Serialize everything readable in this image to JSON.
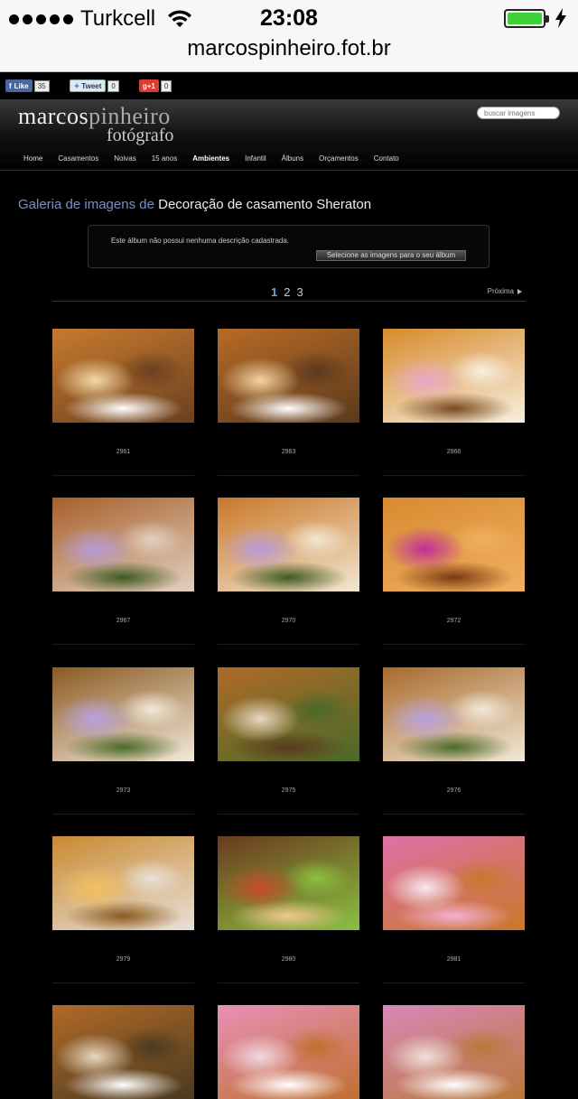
{
  "status": {
    "carrier": "Turkcell",
    "time": "23:08"
  },
  "url": "marcospinheiro.fot.br",
  "social": {
    "like_label": "Like",
    "like_count": "35",
    "tweet_label": "Tweet",
    "tweet_count": "0",
    "gplus_label": "g+1",
    "gplus_count": "0"
  },
  "logo": {
    "part1": "marcos",
    "part2": "pinheiro",
    "line2": "fotógrafo"
  },
  "search": {
    "placeholder": "buscar imagens"
  },
  "nav": [
    "Home",
    "Casamentos",
    "Noivas",
    "15 anos",
    "Ambientes",
    "Infantil",
    "Álbuns",
    "Orçamentos",
    "Contato"
  ],
  "nav_active": "Ambientes",
  "gallery": {
    "prefix": "Galeria de imagens de",
    "name": "Decoração de casamento Sheraton",
    "description": "Este álbum não possui nenhuma descrição cadastrada.",
    "select_button": "Selecione as imagens para o seu álbum"
  },
  "pagination": {
    "pages": [
      "1",
      "2",
      "3"
    ],
    "current": "1",
    "next_label": "Próxima"
  },
  "photos": [
    {
      "id": "2961",
      "palette": [
        "#c77a2e",
        "#f3d9a8",
        "#6b4020",
        "#fff"
      ]
    },
    {
      "id": "2963",
      "palette": [
        "#b86a26",
        "#f2d3a0",
        "#5b3a1c",
        "#fff"
      ]
    },
    {
      "id": "2966",
      "palette": [
        "#d78b2a",
        "#e9a6c8",
        "#f7efe0",
        "#7a4a20"
      ]
    },
    {
      "id": "2967",
      "palette": [
        "#a7602a",
        "#b79ad8",
        "#e2d0c0",
        "#3e5a22"
      ]
    },
    {
      "id": "2970",
      "palette": [
        "#c9782a",
        "#b79ad8",
        "#f2e6d0",
        "#3e5a22"
      ]
    },
    {
      "id": "2972",
      "palette": [
        "#d88a30",
        "#c02e9a",
        "#f0b060",
        "#7a3a10"
      ]
    },
    {
      "id": "2973",
      "palette": [
        "#8a5a22",
        "#b8a0e0",
        "#f2e8d8",
        "#4a6a28"
      ]
    },
    {
      "id": "2975",
      "palette": [
        "#b06a28",
        "#e8d8c0",
        "#4a6a28",
        "#5a3a20"
      ]
    },
    {
      "id": "2976",
      "palette": [
        "#a86a2c",
        "#b8a0e0",
        "#f2e8d8",
        "#4a6a28"
      ]
    },
    {
      "id": "2979",
      "palette": [
        "#c98a30",
        "#f2c060",
        "#e8e0d8",
        "#8a5a20"
      ]
    },
    {
      "id": "2980",
      "palette": [
        "#6b3a1e",
        "#c84a2a",
        "#8ac040",
        "#f0c890"
      ]
    },
    {
      "id": "2981",
      "palette": [
        "#e070a8",
        "#f8e8f0",
        "#c8782a",
        "#f4b0d0"
      ]
    },
    {
      "id": "",
      "palette": [
        "#b06a28",
        "#e8d8c0",
        "#4a3a20",
        "#fff"
      ]
    },
    {
      "id": "",
      "palette": [
        "#e890b8",
        "#f0d8e0",
        "#c07030",
        "#fff"
      ]
    },
    {
      "id": "",
      "palette": [
        "#d888b8",
        "#f0e0d8",
        "#b87838",
        "#fff"
      ]
    }
  ]
}
